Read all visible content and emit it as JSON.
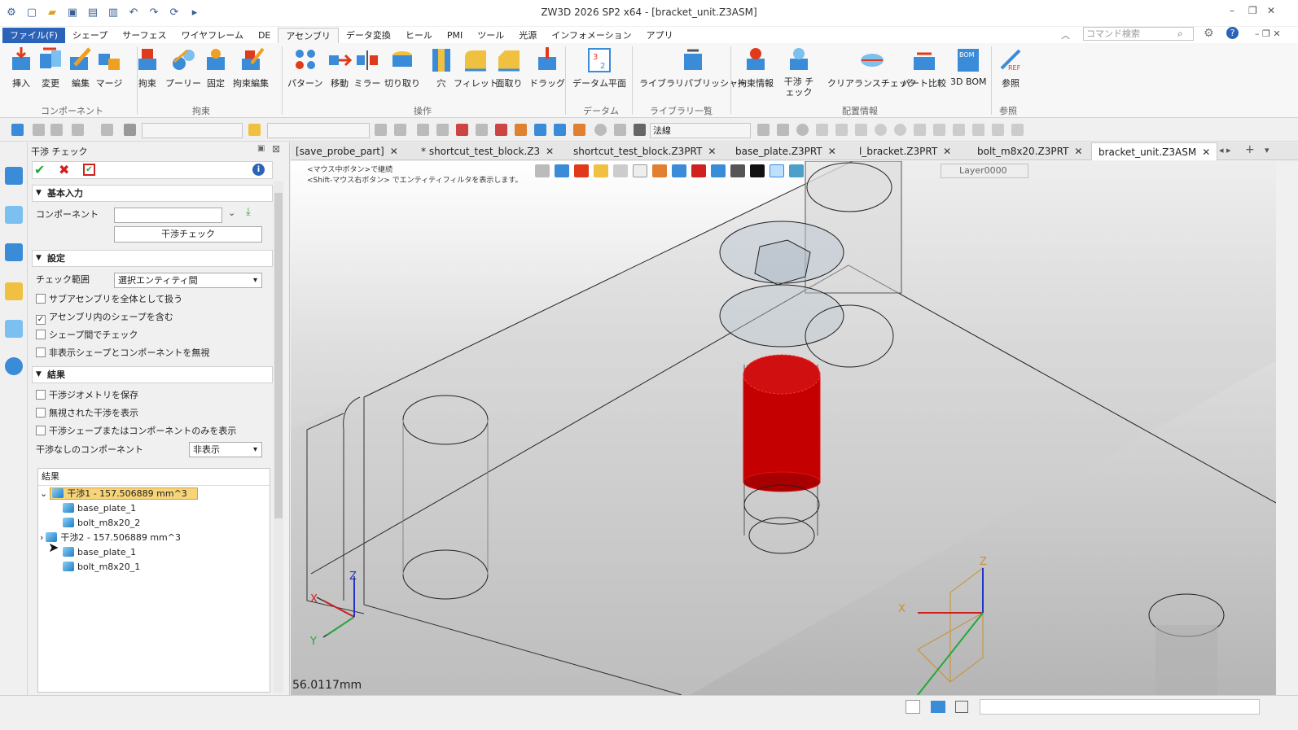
{
  "window": {
    "title": "ZW3D 2026 SP2 x64  - [bracket_unit.Z3ASM]"
  },
  "menu": {
    "items": [
      "ファイル(F)",
      "シェープ",
      "サーフェス",
      "ワイヤフレーム",
      "DE",
      "アセンブリ",
      "データ変換",
      "ヒール",
      "PMI",
      "ツール",
      "光源",
      "インフォメーション",
      "アプリ"
    ],
    "search_placeholder": "コマンド検索"
  },
  "ribbon": {
    "buttons": [
      "挿入",
      "変更",
      "編集",
      "マージ",
      "拘束",
      "プーリー",
      "固定",
      "拘束編集",
      "パターン",
      "移動",
      "ミラー",
      "切り取り",
      "穴",
      "フィレット",
      "面取り",
      "ドラッグ",
      "データム平面",
      "ライブラリパブリッシャー",
      "拘束情報",
      "干渉 チェック",
      "クリアランスチェック",
      "パート比較",
      "3D BOM",
      "参照"
    ],
    "groups": [
      "コンポーネント",
      "拘束",
      "操作",
      "データム",
      "ライブラリ一覧",
      "配置情報",
      "参照"
    ]
  },
  "toolbar2": {
    "filter_value": "法線"
  },
  "panel": {
    "title": "干渉 チェック",
    "basic_section": "基本入力",
    "component_label": "コンポーネント",
    "check_button": "干渉チェック",
    "settings_section": "設定",
    "check_range_label": "チェック範囲",
    "check_range_value": "選択エンティティ間",
    "options": [
      {
        "label": "サブアセンブリを全体として扱う",
        "checked": false
      },
      {
        "label": "アセンブリ内のシェープを含む",
        "checked": true
      },
      {
        "label": "シェープ間でチェック",
        "checked": false
      },
      {
        "label": "非表示シェープとコンポーネントを無視",
        "checked": false
      }
    ],
    "results_section": "結果",
    "result_options": [
      {
        "label": "干渉ジオメトリを保存",
        "checked": false
      },
      {
        "label": "無視された干渉を表示",
        "checked": false
      },
      {
        "label": "干渉シェープまたはコンポーネントのみを表示",
        "checked": false
      }
    ],
    "no_interference_label": "干渉なしのコンポーネント",
    "no_interference_value": "非表示",
    "results_header": "結果",
    "results": [
      {
        "label": "干渉1 - 157.506889 mm^3",
        "children": [
          "base_plate_1",
          "bolt_m8x20_2"
        ]
      },
      {
        "label": "干渉2 - 157.506889 mm^3",
        "children": [
          "base_plate_1",
          "bolt_m8x20_1"
        ]
      }
    ]
  },
  "tabs": [
    "[save_probe_part]",
    "* shortcut_test_block.Z3",
    "shortcut_test_block.Z3PRT",
    "base_plate.Z3PRT",
    "l_bracket.Z3PRT",
    "bolt_m8x20.Z3PRT",
    "bracket_unit.Z3ASM"
  ],
  "viewport": {
    "hint1": "<マウス中ボタン>で継続",
    "hint2": "<Shift-マウス右ボタン> でエンティティフィルタを表示します。",
    "layer": "Layer0000",
    "measurement": "56.0117mm",
    "axis_x": "X",
    "axis_y": "Y",
    "axis_z": "Z",
    "highlight_color": "#e01010"
  }
}
